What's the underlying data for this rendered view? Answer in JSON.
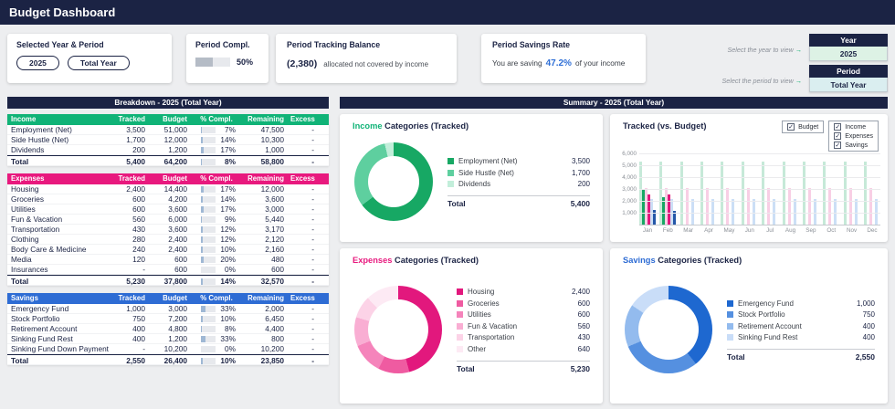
{
  "header": {
    "title": "Budget Dashboard"
  },
  "icons": {
    "check": "✓"
  },
  "top": {
    "year_period": {
      "title": "Selected Year & Period",
      "year_button": "2025",
      "period_button": "Total Year"
    },
    "period_compl": {
      "title": "Period Compl.",
      "percent": "50%",
      "percent_value": 50
    },
    "tracking_balance": {
      "title": "Period Tracking Balance",
      "value": "(2,380)",
      "caption": "allocated not covered by income"
    },
    "savings_rate": {
      "title": "Period Savings Rate",
      "prefix": "You are saving",
      "value": "47.2%",
      "suffix": "of your income"
    },
    "selectors": {
      "year_hint": "Select the year to view",
      "period_hint": "Select the period to view",
      "arrow": "→",
      "year_label": "Year",
      "year_value": "2025",
      "period_label": "Period",
      "period_value": "Total Year"
    }
  },
  "breakdown": {
    "title": "Breakdown - 2025 (Total Year)",
    "columns": [
      "Tracked",
      "Budget",
      "% Compl.",
      "Remaining",
      "Excess"
    ],
    "tables": [
      {
        "name": "Income",
        "header_color": "#10b377",
        "rows": [
          {
            "label": "Employment (Net)",
            "tracked": "3,500",
            "budget": "51,000",
            "compl": "7%",
            "compl_value": 7,
            "remaining": "47,500",
            "excess": "-"
          },
          {
            "label": "Side Hustle (Net)",
            "tracked": "1,700",
            "budget": "12,000",
            "compl": "14%",
            "compl_value": 14,
            "remaining": "10,300",
            "excess": "-"
          },
          {
            "label": "Dividends",
            "tracked": "200",
            "budget": "1,200",
            "compl": "17%",
            "compl_value": 17,
            "remaining": "1,000",
            "excess": "-"
          }
        ],
        "total": {
          "label": "Total",
          "tracked": "5,400",
          "budget": "64,200",
          "compl": "8%",
          "compl_value": 8,
          "remaining": "58,800",
          "excess": "-"
        }
      },
      {
        "name": "Expenses",
        "header_color": "#e8197e",
        "rows": [
          {
            "label": "Housing",
            "tracked": "2,400",
            "budget": "14,400",
            "compl": "17%",
            "compl_value": 17,
            "remaining": "12,000",
            "excess": "-"
          },
          {
            "label": "Groceries",
            "tracked": "600",
            "budget": "4,200",
            "compl": "14%",
            "compl_value": 14,
            "remaining": "3,600",
            "excess": "-"
          },
          {
            "label": "Utilities",
            "tracked": "600",
            "budget": "3,600",
            "compl": "17%",
            "compl_value": 17,
            "remaining": "3,000",
            "excess": "-"
          },
          {
            "label": "Fun & Vacation",
            "tracked": "560",
            "budget": "6,000",
            "compl": "9%",
            "compl_value": 9,
            "remaining": "5,440",
            "excess": "-"
          },
          {
            "label": "Transportation",
            "tracked": "430",
            "budget": "3,600",
            "compl": "12%",
            "compl_value": 12,
            "remaining": "3,170",
            "excess": "-"
          },
          {
            "label": "Clothing",
            "tracked": "280",
            "budget": "2,400",
            "compl": "12%",
            "compl_value": 12,
            "remaining": "2,120",
            "excess": "-"
          },
          {
            "label": "Body Care & Medicine",
            "tracked": "240",
            "budget": "2,400",
            "compl": "10%",
            "compl_value": 10,
            "remaining": "2,160",
            "excess": "-"
          },
          {
            "label": "Media",
            "tracked": "120",
            "budget": "600",
            "compl": "20%",
            "compl_value": 20,
            "remaining": "480",
            "excess": "-"
          },
          {
            "label": "Insurances",
            "tracked": "-",
            "budget": "600",
            "compl": "0%",
            "compl_value": 0,
            "remaining": "600",
            "excess": "-"
          }
        ],
        "total": {
          "label": "Total",
          "tracked": "5,230",
          "budget": "37,800",
          "compl": "14%",
          "compl_value": 14,
          "remaining": "32,570",
          "excess": "-"
        }
      },
      {
        "name": "Savings",
        "header_color": "#2e6cd4",
        "rows": [
          {
            "label": "Emergency Fund",
            "tracked": "1,000",
            "budget": "3,000",
            "compl": "33%",
            "compl_value": 33,
            "remaining": "2,000",
            "excess": "-"
          },
          {
            "label": "Stock Portfolio",
            "tracked": "750",
            "budget": "7,200",
            "compl": "10%",
            "compl_value": 10,
            "remaining": "6,450",
            "excess": "-"
          },
          {
            "label": "Retirement Account",
            "tracked": "400",
            "budget": "4,800",
            "compl": "8%",
            "compl_value": 8,
            "remaining": "4,400",
            "excess": "-"
          },
          {
            "label": "Sinking Fund Rest",
            "tracked": "400",
            "budget": "1,200",
            "compl": "33%",
            "compl_value": 33,
            "remaining": "800",
            "excess": "-"
          },
          {
            "label": "Sinking Fund Down Payment",
            "tracked": "-",
            "budget": "10,200",
            "compl": "0%",
            "compl_value": 0,
            "remaining": "10,200",
            "excess": "-"
          }
        ],
        "total": {
          "label": "Total",
          "tracked": "2,550",
          "budget": "26,400",
          "compl": "10%",
          "compl_value": 10,
          "remaining": "23,850",
          "excess": "-"
        }
      }
    ]
  },
  "summary": {
    "title": "Summary - 2025 (Total Year)"
  },
  "chart_data": [
    {
      "type": "pie",
      "id": "income",
      "title": "Income Categories (Tracked)",
      "title_accent": "Income",
      "title_rest": " Categories (Tracked)",
      "accent_color": "#10b377",
      "slices": [
        {
          "label": "Employment (Net)",
          "value": 3500,
          "display": "3,500",
          "color": "#17a864"
        },
        {
          "label": "Side Hustle (Net)",
          "value": 1700,
          "display": "1,700",
          "color": "#5ecf9f"
        },
        {
          "label": "Dividends",
          "value": 200,
          "display": "200",
          "color": "#c2eeda"
        }
      ],
      "total_label": "Total",
      "total_display": "5,400"
    },
    {
      "type": "bar",
      "id": "bars",
      "title": "Tracked (vs. Budget)",
      "legend": {
        "budget": "Budget",
        "series": [
          "Income",
          "Expenses",
          "Savings"
        ]
      },
      "categories": [
        "Jan",
        "Feb",
        "Mar",
        "Apr",
        "May",
        "Jun",
        "Jul",
        "Aug",
        "Sep",
        "Oct",
        "Nov",
        "Dec"
      ],
      "ylim": [
        0,
        6000
      ],
      "yticks": [
        "1,000",
        "2,000",
        "3,000",
        "4,000",
        "5,000",
        "6,000"
      ],
      "series": [
        {
          "name": "Income Budget",
          "role": "budget",
          "color": "#c6e9d8",
          "values": [
            5350,
            5350,
            5350,
            5350,
            5350,
            5350,
            5350,
            5350,
            5350,
            5350,
            5350,
            5350
          ]
        },
        {
          "name": "Income Tracked",
          "role": "tracked",
          "color": "#17a864",
          "values": [
            3000,
            2400,
            0,
            0,
            0,
            0,
            0,
            0,
            0,
            0,
            0,
            0
          ]
        },
        {
          "name": "Expenses Budget",
          "role": "budget",
          "color": "#f8cfe5",
          "values": [
            3150,
            3150,
            3150,
            3150,
            3150,
            3150,
            3150,
            3150,
            3150,
            3150,
            3150,
            3150
          ]
        },
        {
          "name": "Expenses Tracked",
          "role": "tracked",
          "color": "#e2187d",
          "values": [
            2650,
            2580,
            0,
            0,
            0,
            0,
            0,
            0,
            0,
            0,
            0,
            0
          ]
        },
        {
          "name": "Savings Budget",
          "role": "budget",
          "color": "#ccdff6",
          "values": [
            2200,
            2200,
            2200,
            2200,
            2200,
            2200,
            2200,
            2200,
            2200,
            2200,
            2200,
            2200
          ]
        },
        {
          "name": "Savings Tracked",
          "role": "tracked",
          "color": "#2457a8",
          "values": [
            1300,
            1250,
            0,
            0,
            0,
            0,
            0,
            0,
            0,
            0,
            0,
            0
          ]
        }
      ]
    },
    {
      "type": "pie",
      "id": "expenses",
      "title": "Expenses Categories (Tracked)",
      "title_accent": "Expenses",
      "title_rest": " Categories (Tracked)",
      "accent_color": "#e8197e",
      "slices": [
        {
          "label": "Housing",
          "value": 2400,
          "display": "2,400",
          "color": "#e2187d"
        },
        {
          "label": "Groceries",
          "value": 600,
          "display": "600",
          "color": "#ef5ba1"
        },
        {
          "label": "Utilities",
          "value": 600,
          "display": "600",
          "color": "#f584bb"
        },
        {
          "label": "Fun & Vacation",
          "value": 560,
          "display": "560",
          "color": "#f9aed3"
        },
        {
          "label": "Transportation",
          "value": 430,
          "display": "430",
          "color": "#fcd3e7"
        },
        {
          "label": "Other",
          "value": 640,
          "display": "640",
          "color": "#fdeaf4"
        }
      ],
      "total_label": "Total",
      "total_display": "5,230"
    },
    {
      "type": "pie",
      "id": "savings",
      "title": "Savings Categories (Tracked)",
      "title_accent": "Savings",
      "title_rest": " Categories (Tracked)",
      "accent_color": "#2e6cd4",
      "slices": [
        {
          "label": "Emergency Fund",
          "value": 1000,
          "display": "1,000",
          "color": "#1e68d0"
        },
        {
          "label": "Stock Portfolio",
          "value": 750,
          "display": "750",
          "color": "#5590e0"
        },
        {
          "label": "Retirement Account",
          "value": 400,
          "display": "400",
          "color": "#93bbee"
        },
        {
          "label": "Sinking Fund Rest",
          "value": 400,
          "display": "400",
          "color": "#c9ddf8"
        }
      ],
      "total_label": "Total",
      "total_display": "2,550"
    }
  ]
}
